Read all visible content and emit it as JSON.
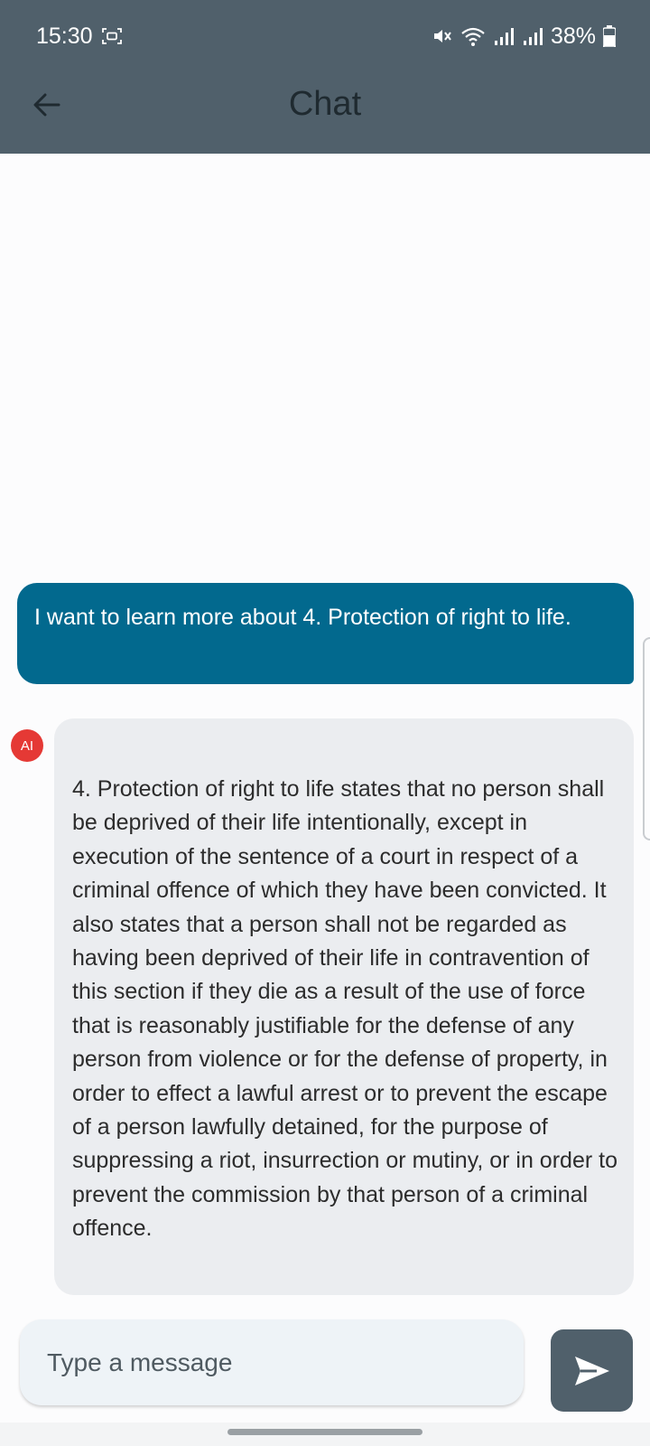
{
  "status_bar": {
    "time": "15:30",
    "battery_percent": "38%",
    "icons": [
      "screen-record-icon",
      "mute-icon",
      "wifi-icon",
      "signal-icon",
      "signal-icon-2",
      "battery-icon"
    ]
  },
  "header": {
    "title": "Chat",
    "back_icon": "back-arrow-icon",
    "background_color": "#50606b"
  },
  "messages": [
    {
      "role": "user",
      "text": "I want to learn more about 4. Protection of right to life.",
      "color": "#02698e"
    },
    {
      "role": "ai",
      "avatar_label": "AI",
      "avatar_color": "#e53935",
      "text": "4. Protection of right to life states that no person shall be deprived of their life intentionally, except in execution of the sentence of a court in respect of a criminal offence of which they have been convicted. It also states that a person shall not be regarded as having been deprived of their life in contravention of this section if they die as a result of the use of force that is reasonably justifiable for the defense of any person from violence or for the defense of property, in order to effect a lawful arrest or to prevent the escape of a person lawfully detained, for the purpose of suppressing a riot, insurrection or mutiny, or in order to prevent the commission by that person of a criminal offence.",
      "color": "#ebedf0"
    }
  ],
  "composer": {
    "placeholder": "Type a message",
    "value": "",
    "send_icon": "send-icon"
  }
}
